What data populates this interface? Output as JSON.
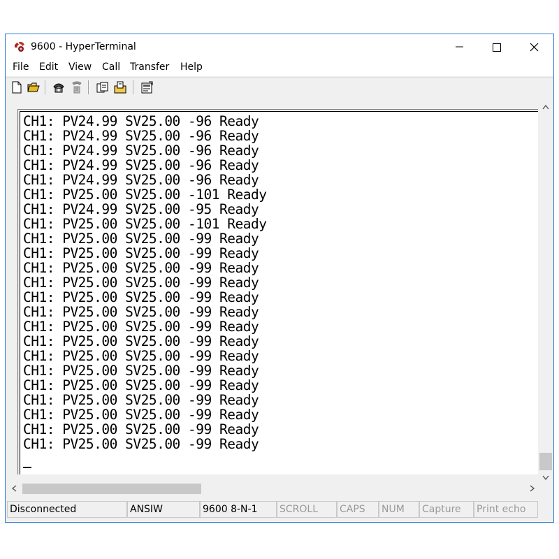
{
  "window": {
    "title": "9600 - HyperTerminal",
    "app_icon": "hyperterminal-phone-icon",
    "border_color": "#2f7fd2",
    "caption_buttons": [
      "minimize-icon",
      "maximize-icon",
      "close-icon"
    ]
  },
  "menu": {
    "items": [
      "File",
      "Edit",
      "View",
      "Call",
      "Transfer",
      "Help"
    ]
  },
  "toolbar": {
    "icons": [
      "new-connection-icon",
      "open-icon",
      "dial-icon",
      "disconnect-icon",
      "send-icon",
      "receive-icon",
      "properties-icon"
    ]
  },
  "terminal": {
    "lines": [
      "CH1: PV24.99 SV25.00 -96 Ready",
      "CH1: PV24.99 SV25.00 -96 Ready",
      "CH1: PV24.99 SV25.00 -96 Ready",
      "CH1: PV24.99 SV25.00 -96 Ready",
      "CH1: PV24.99 SV25.00 -96 Ready",
      "CH1: PV25.00 SV25.00 -101 Ready",
      "CH1: PV24.99 SV25.00 -95 Ready",
      "CH1: PV25.00 SV25.00 -101 Ready",
      "CH1: PV25.00 SV25.00 -99 Ready",
      "CH1: PV25.00 SV25.00 -99 Ready",
      "CH1: PV25.00 SV25.00 -99 Ready",
      "CH1: PV25.00 SV25.00 -99 Ready",
      "CH1: PV25.00 SV25.00 -99 Ready",
      "CH1: PV25.00 SV25.00 -99 Ready",
      "CH1: PV25.00 SV25.00 -99 Ready",
      "CH1: PV25.00 SV25.00 -99 Ready",
      "CH1: PV25.00 SV25.00 -99 Ready",
      "CH1: PV25.00 SV25.00 -99 Ready",
      "CH1: PV25.00 SV25.00 -99 Ready",
      "CH1: PV25.00 SV25.00 -99 Ready",
      "CH1: PV25.00 SV25.00 -99 Ready",
      "CH1: PV25.00 SV25.00 -99 Ready",
      "CH1: PV25.00 SV25.00 -99 Ready"
    ]
  },
  "status": {
    "connection": "Disconnected",
    "emulation": "ANSIW",
    "port_settings": "9600 8-N-1",
    "scroll": "SCROLL",
    "caps": "CAPS",
    "num": "NUM",
    "capture": "Capture",
    "print_echo": "Print echo"
  }
}
